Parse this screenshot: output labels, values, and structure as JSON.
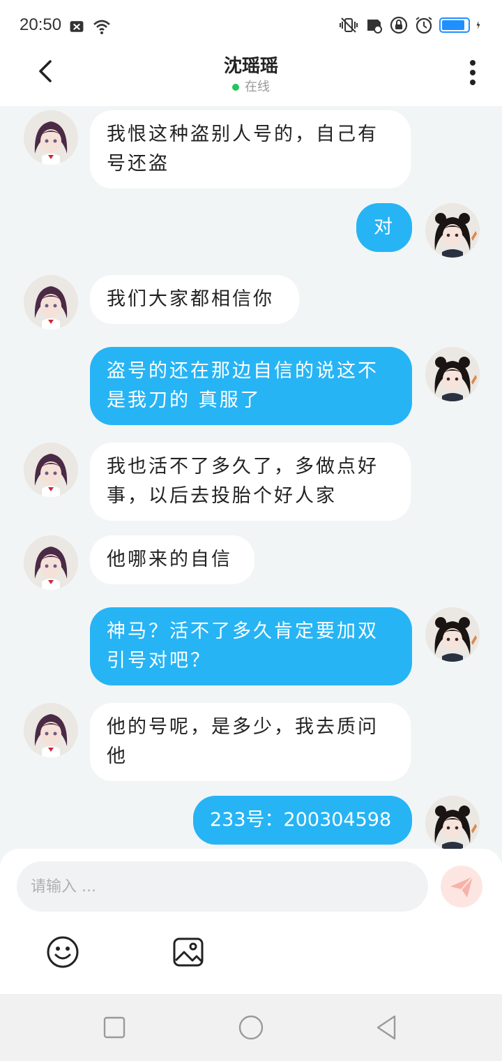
{
  "status_bar": {
    "time": "20:50",
    "battery_level": 0.9,
    "icons": [
      "close-box-icon",
      "wifi-icon",
      "vibrate-icon",
      "sim-icon",
      "lock-rotation-icon",
      "alarm-icon",
      "battery-icon",
      "charging-icon"
    ]
  },
  "header": {
    "title": "沈瑶瑶",
    "status": "在线",
    "status_color": "#22c55e"
  },
  "messages": [
    {
      "side": "in",
      "text": "我恨这种盗别人号的，自己有号还盗"
    },
    {
      "side": "out",
      "text": "对"
    },
    {
      "side": "in",
      "text": "我们大家都相信你"
    },
    {
      "side": "out",
      "text": "盗号的还在那边自信的说这不是我刀的 真服了"
    },
    {
      "side": "in",
      "text": "我也活不了多久了，多做点好事，以后去投胎个好人家"
    },
    {
      "side": "in",
      "text": "他哪来的自信"
    },
    {
      "side": "out",
      "text": "神马？活不了多久肯定要加双引号对吧？"
    },
    {
      "side": "in",
      "text": "他的号呢，是多少，我去质问他"
    },
    {
      "side": "out",
      "text": "233号：200304598"
    }
  ],
  "input": {
    "placeholder": "请输入 ..."
  },
  "colors": {
    "outgoing_bubble": "#26b4f5",
    "incoming_bubble": "#ffffff",
    "background": "#f2f5f6",
    "send_button": "#fde6e2"
  }
}
